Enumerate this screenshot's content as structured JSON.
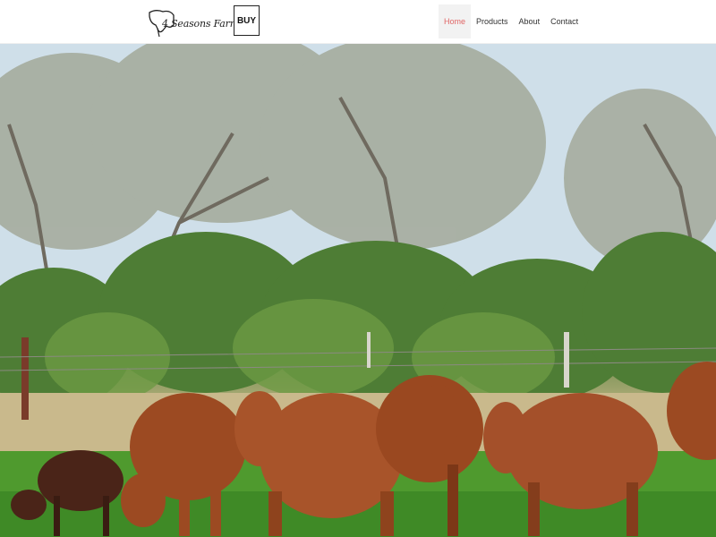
{
  "brand": {
    "logo_text": "4 Seasons Farm",
    "buy_label": "BUY"
  },
  "nav": {
    "items": [
      {
        "label": "Home",
        "active": true
      },
      {
        "label": "Products",
        "active": false
      },
      {
        "label": "About",
        "active": false
      },
      {
        "label": "Contact",
        "active": false
      }
    ]
  },
  "hero": {
    "image_alt": "Red cattle grazing in a green pasture in front of trees"
  },
  "colors": {
    "accent": "#e06666",
    "text": "#333333"
  }
}
